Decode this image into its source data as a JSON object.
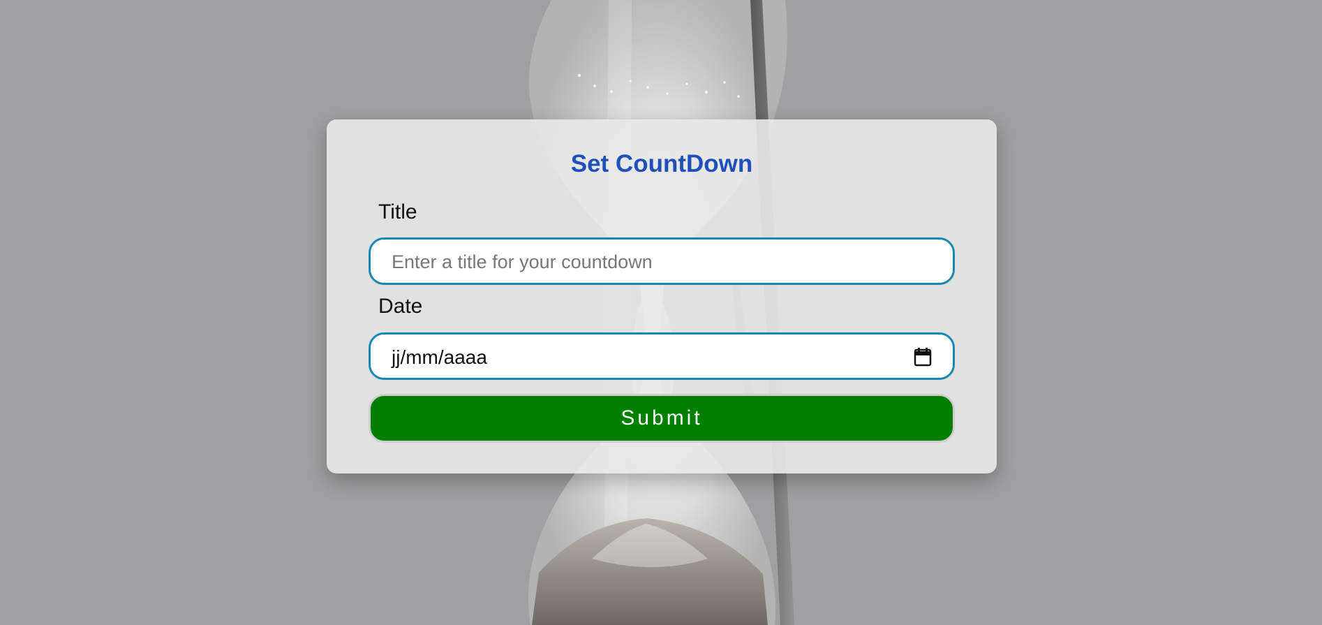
{
  "form": {
    "title": "Set CountDown",
    "title_label": "Title",
    "title_placeholder": "Enter a title for your countdown",
    "title_value": "",
    "date_label": "Date",
    "date_value": "jj/mm/aaaa",
    "submit_label": "Submit"
  },
  "icons": {
    "background": "hourglass-background",
    "date": "calendar-icon"
  },
  "colors": {
    "heading": "#1f4fb8",
    "input_border": "#1689b3",
    "submit_background": "#008000",
    "submit_text": "#ffffff"
  }
}
